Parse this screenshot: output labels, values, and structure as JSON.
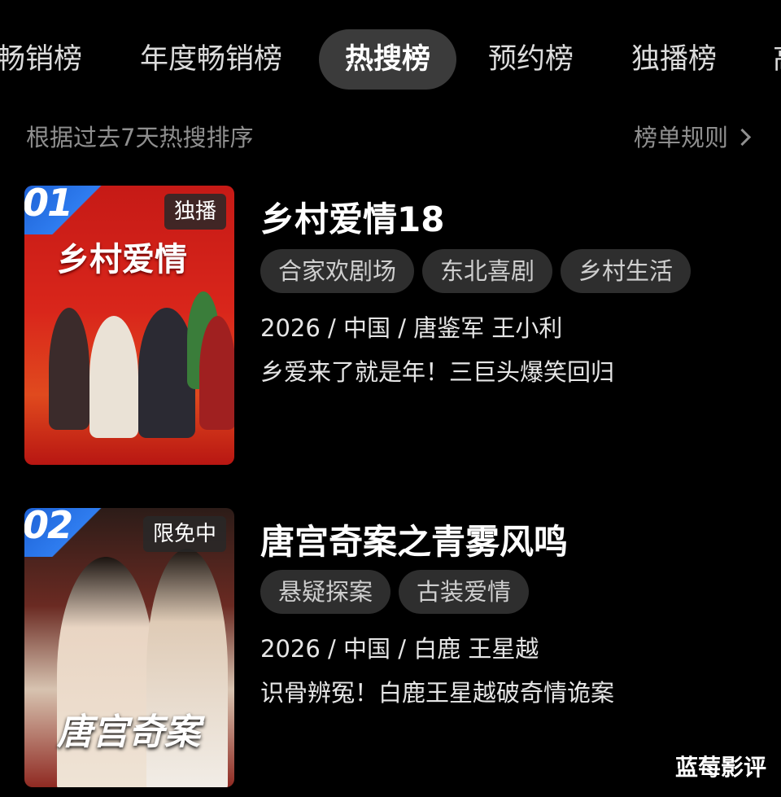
{
  "tabs": [
    {
      "label": "畅销榜"
    },
    {
      "label": "年度畅销榜"
    },
    {
      "label": "热搜榜"
    },
    {
      "label": "预约榜"
    },
    {
      "label": "独播榜"
    },
    {
      "label": "高"
    }
  ],
  "active_tab": "热搜榜",
  "subtitle": "根据过去7天热搜排序",
  "rules_link": "榜单规则",
  "items": [
    {
      "rank": "01",
      "badge": "独播",
      "poster_text": "乡村爱情",
      "title": "乡村爱情18",
      "tags": [
        "合家欢剧场",
        "东北喜剧",
        "乡村生活"
      ],
      "meta": "2026 / 中国 / 唐鉴军 王小利",
      "desc": "乡爱来了就是年！三巨头爆笑回归"
    },
    {
      "rank": "02",
      "badge": "限免中",
      "poster_text": "唐宫奇案",
      "title": "唐宫奇案之青雾风鸣",
      "tags": [
        "悬疑探案",
        "古装爱情"
      ],
      "meta": "2026 / 中国 / 白鹿 王星越",
      "desc": "识骨辨冤！白鹿王星越破奇情诡案"
    }
  ],
  "watermark": "蓝莓影评"
}
